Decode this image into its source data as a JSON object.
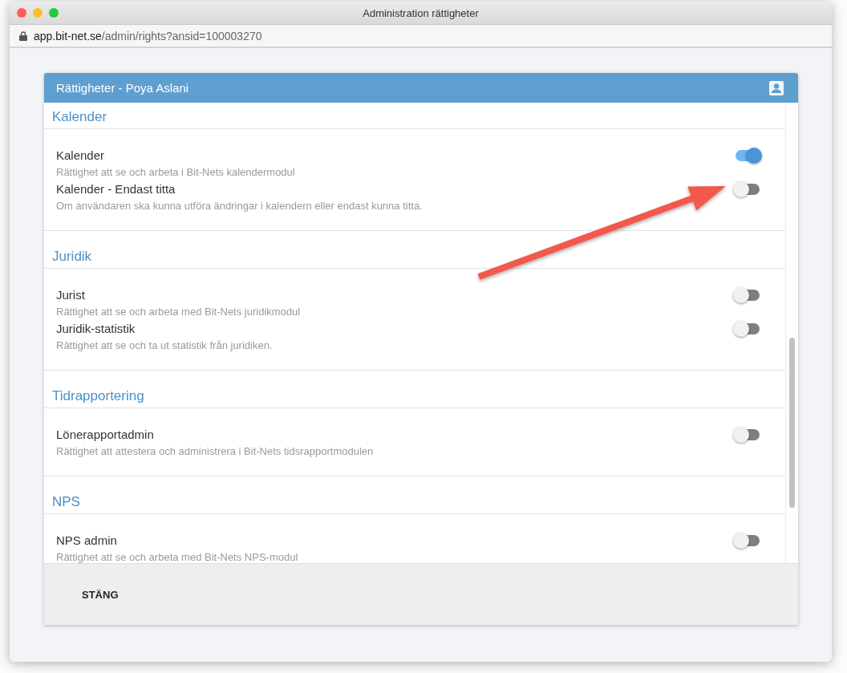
{
  "window": {
    "title": "Administration rättigheter",
    "url_host": "app.bit-net.se",
    "url_path": "/admin/rights?ansid=100003270"
  },
  "dialog": {
    "title": "Rättigheter - Poya Aslani",
    "sections": [
      {
        "heading": "Kalender",
        "items": [
          {
            "title": "Kalender",
            "description": "Rättighet att se och arbeta i Bit-Nets kalendermodul",
            "on": true
          },
          {
            "title": "Kalender - Endast titta",
            "description": "Om användaren ska kunna utföra ändringar i kalendern eller endast kunna titta.",
            "on": false
          }
        ]
      },
      {
        "heading": "Juridik",
        "items": [
          {
            "title": "Jurist",
            "description": "Rättighet att se och arbeta med Bit-Nets juridikmodul",
            "on": false
          },
          {
            "title": "Juridik-statistik",
            "description": "Rättighet att se och ta ut statistik från juridiken.",
            "on": false
          }
        ]
      },
      {
        "heading": "Tidrapportering",
        "items": [
          {
            "title": "Lönerapportadmin",
            "description": "Rättighet att attestera och administrera i Bit-Nets tidsrapportmodulen",
            "on": false
          }
        ]
      },
      {
        "heading": "NPS",
        "items": [
          {
            "title": "NPS admin",
            "description": "Rättighet att se och arbeta med Bit-Nets NPS-modul",
            "on": false
          }
        ]
      }
    ],
    "close_button": "STÄNG"
  }
}
